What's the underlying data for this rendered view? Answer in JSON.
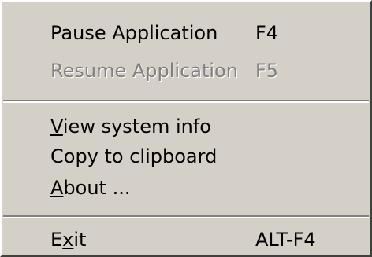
{
  "menu": {
    "items": [
      {
        "id": "pause",
        "label": "Pause Application",
        "shortcut": "F4",
        "enabled": true
      },
      {
        "id": "resume",
        "label": "Resume Application",
        "shortcut": "F5",
        "enabled": false
      },
      {
        "id": "view",
        "label_pre": "",
        "label_accel": "V",
        "label_post": "iew system info",
        "shortcut": "",
        "enabled": true
      },
      {
        "id": "copy",
        "label": "Copy to clipboard",
        "shortcut": "",
        "enabled": true
      },
      {
        "id": "about",
        "label_pre": "",
        "label_accel": "A",
        "label_post": "bout ...",
        "shortcut": "",
        "enabled": true
      },
      {
        "id": "exit",
        "label_pre": "E",
        "label_accel": "x",
        "label_post": "it",
        "shortcut": "ALT-F4",
        "enabled": true
      }
    ]
  },
  "colors": {
    "face": "#d4d0c8",
    "disabled_text": "#808080",
    "shadow": "#808080",
    "highlight": "#ffffff"
  }
}
